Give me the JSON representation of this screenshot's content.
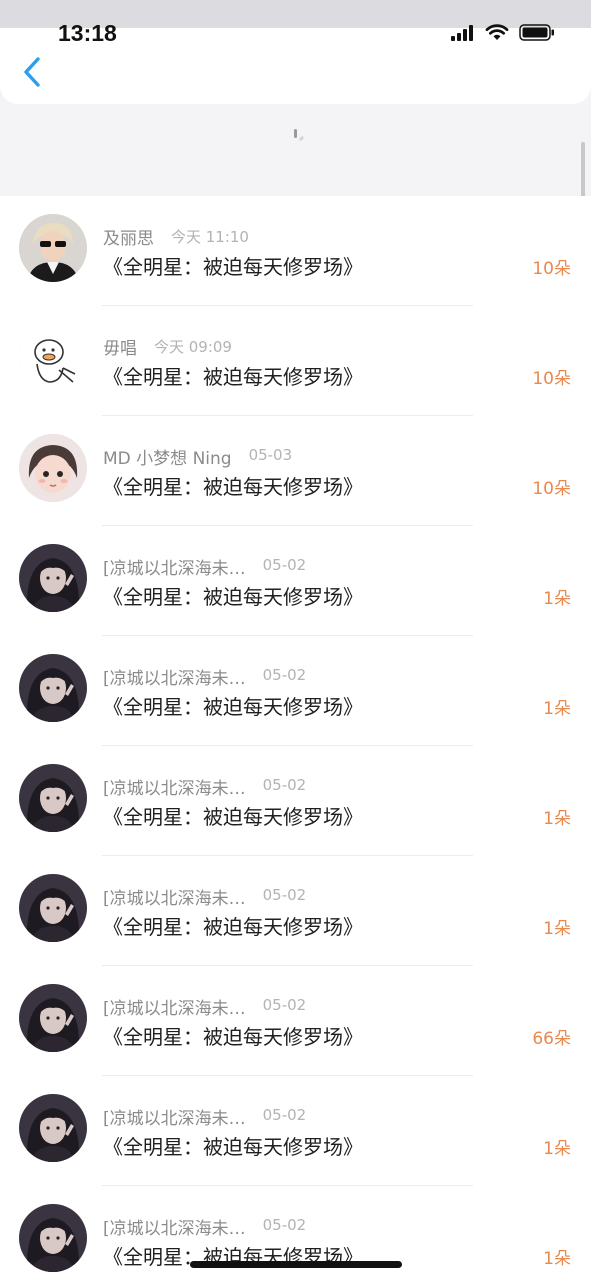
{
  "status_bar": {
    "time": "13:18",
    "icons": [
      "signal-icon",
      "wifi-icon",
      "battery-icon"
    ]
  },
  "nav": {
    "back_icon": "chevron-left-icon",
    "accent_color": "#2b9ef0"
  },
  "colors": {
    "amount": "#e8894f",
    "name": "#8b8b8b",
    "time": "#b3b3b3",
    "title": "#1f1f1f"
  },
  "records": [
    {
      "name": "及丽思",
      "time": "今天 11:10",
      "title": "《全明星：被迫每天修罗场》",
      "amount": "10朵",
      "avatar": "avatar-boy-sunglasses"
    },
    {
      "name": "毋唱",
      "time": "今天 09:09",
      "title": "《全明星：被迫每天修罗场》",
      "amount": "10朵",
      "avatar": "avatar-cartoon-duck"
    },
    {
      "name": "MD 小梦想 Ning",
      "time": "05-03",
      "title": "《全明星：被迫每天修罗场》",
      "amount": "10朵",
      "avatar": "avatar-girl-cartoon"
    },
    {
      "name": "[凉城以北深海未…",
      "time": "05-02",
      "title": "《全明星：被迫每天修罗场》",
      "amount": "1朵",
      "avatar": "avatar-girl-dark"
    },
    {
      "name": "[凉城以北深海未…",
      "time": "05-02",
      "title": "《全明星：被迫每天修罗场》",
      "amount": "1朵",
      "avatar": "avatar-girl-dark"
    },
    {
      "name": "[凉城以北深海未…",
      "time": "05-02",
      "title": "《全明星：被迫每天修罗场》",
      "amount": "1朵",
      "avatar": "avatar-girl-dark"
    },
    {
      "name": "[凉城以北深海未…",
      "time": "05-02",
      "title": "《全明星：被迫每天修罗场》",
      "amount": "1朵",
      "avatar": "avatar-girl-dark"
    },
    {
      "name": "[凉城以北深海未…",
      "time": "05-02",
      "title": "《全明星：被迫每天修罗场》",
      "amount": "66朵",
      "avatar": "avatar-girl-dark"
    },
    {
      "name": "[凉城以北深海未…",
      "time": "05-02",
      "title": "《全明星：被迫每天修罗场》",
      "amount": "1朵",
      "avatar": "avatar-girl-dark"
    },
    {
      "name": "[凉城以北深海未…",
      "time": "05-02",
      "title": "《全明星：被迫每天修罗场》",
      "amount": "1朵",
      "avatar": "avatar-girl-dark"
    }
  ]
}
